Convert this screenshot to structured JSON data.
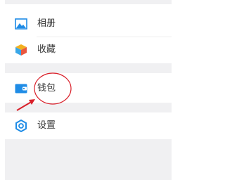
{
  "menu": {
    "items": [
      {
        "label": "相册",
        "icon": "photo-album-icon"
      },
      {
        "label": "收藏",
        "icon": "favorites-cube-icon"
      },
      {
        "label": "钱包",
        "icon": "wallet-icon"
      },
      {
        "label": "设置",
        "icon": "gear-icon"
      }
    ]
  },
  "colors": {
    "accent_blue": "#1f8ce6",
    "annotation_red": "#d9202a",
    "section_gap": "#f0f0f2"
  }
}
